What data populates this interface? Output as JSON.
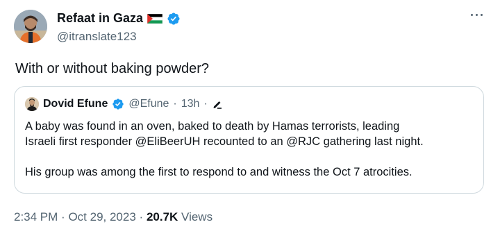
{
  "author": {
    "display_name": "Refaat in Gaza",
    "handle": "@itranslate123",
    "flag_icon": "palestine-flag-icon",
    "verified_color": "#1d9bf0"
  },
  "tweet": {
    "text": "With or without baking powder?"
  },
  "quoted": {
    "display_name": "Dovid Efune",
    "handle": "@Efune",
    "separator": "·",
    "time": "13h",
    "edit_icon": "edit-pencil-icon",
    "paragraphs": [
      "A baby was found in an oven, baked to death by Hamas terrorists, leading",
      "Israeli first responder @EliBeerUH recounted to an @RJC gathering last night.",
      "His group was among the first to respond to and witness the Oct 7 atrocities."
    ]
  },
  "footer": {
    "time": "2:34 PM",
    "date": "Oct 29, 2023",
    "separator": "·",
    "views_count": "20.7K",
    "views_label": "Views"
  },
  "colors": {
    "text_primary": "#0f1419",
    "text_secondary": "#536471",
    "border": "#cfd9de",
    "verified_blue": "#1d9bf0"
  }
}
